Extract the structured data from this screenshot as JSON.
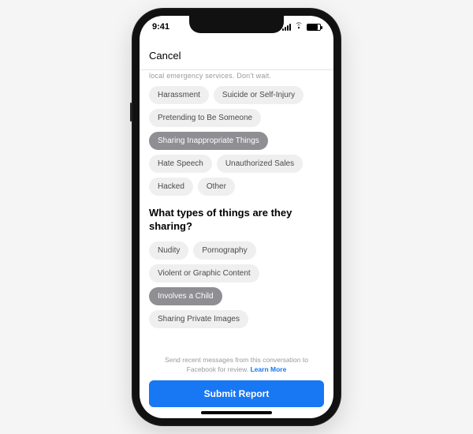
{
  "status": {
    "time": "9:41"
  },
  "header": {
    "cancel": "Cancel"
  },
  "cutoff": "local emergency services. Don't wait.",
  "primary_chips": {
    "harassment": "Harassment",
    "suicide": "Suicide or Self-Injury",
    "pretending": "Pretending to Be Someone",
    "sharing": "Sharing Inappropriate Things",
    "hate": "Hate Speech",
    "unauthorized": "Unauthorized Sales",
    "hacked": "Hacked",
    "other": "Other"
  },
  "question": "What types of things are they sharing?",
  "secondary_chips": {
    "nudity": "Nudity",
    "porn": "Pornography",
    "violent": "Violent or Graphic Content",
    "child": "Involves a Child",
    "private": "Sharing Private Images"
  },
  "disclaimer": {
    "text": "Send recent messages from this conversation to Facebook for review.",
    "link": "Learn More"
  },
  "submit": "Submit Report"
}
